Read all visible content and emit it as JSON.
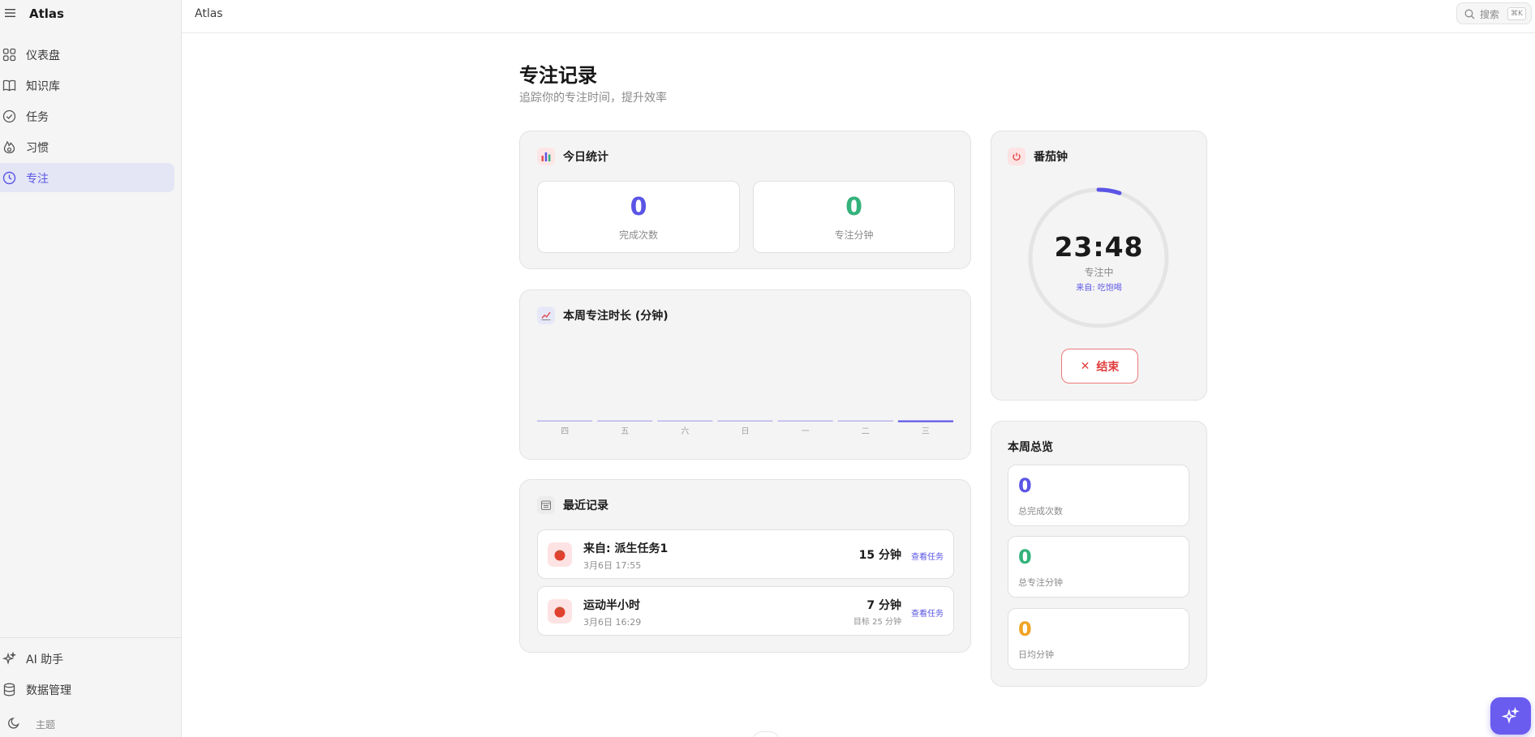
{
  "app": {
    "name": "Atlas"
  },
  "sidebar": {
    "items": [
      {
        "label": "仪表盘",
        "icon": "dashboard-icon"
      },
      {
        "label": "知识库",
        "icon": "book-icon"
      },
      {
        "label": "任务",
        "icon": "check-circle-icon"
      },
      {
        "label": "习惯",
        "icon": "flame-icon"
      },
      {
        "label": "专注",
        "icon": "clock-icon",
        "active": true
      }
    ],
    "bottom": [
      {
        "label": "AI 助手",
        "icon": "sparkle-icon"
      },
      {
        "label": "数据管理",
        "icon": "database-icon"
      },
      {
        "label": "主题",
        "icon": "moon-icon"
      }
    ]
  },
  "topbar": {
    "breadcrumb": "Atlas",
    "search_placeholder": "搜索",
    "search_shortcut": "⌘K"
  },
  "page": {
    "title": "专注记录",
    "subtitle": "追踪你的专注时间，提升效率"
  },
  "today": {
    "title": "今日统计",
    "completed": {
      "value": "0",
      "label": "完成次数"
    },
    "minutes": {
      "value": "0",
      "label": "专注分钟"
    }
  },
  "week_chart": {
    "title": "本周专注时长 (分钟)"
  },
  "chart_data": {
    "type": "bar",
    "title": "本周专注时长 (分钟)",
    "categories": [
      "四",
      "五",
      "六",
      "日",
      "一",
      "二",
      "三"
    ],
    "values": [
      0,
      0,
      0,
      0,
      0,
      0,
      0
    ],
    "highlight_index": 6
  },
  "recent": {
    "title": "最近记录",
    "items": [
      {
        "title": "来自: 派生任务1",
        "time": "3月6日 17:55",
        "duration": "15 分钟",
        "goal": "",
        "link": "查看任务"
      },
      {
        "title": "运动半小时",
        "time": "3月6日 16:29",
        "duration": "7 分钟",
        "goal": "目标 25 分钟",
        "link": "查看任务"
      }
    ]
  },
  "pomodoro": {
    "title": "番茄钟",
    "time": "23:48",
    "state": "专注中",
    "source": "来自: 吃饱喝",
    "progress": 0.05,
    "end_label": "结束"
  },
  "overview": {
    "title": "本周总览",
    "items": [
      {
        "value": "0",
        "label": "总完成次数",
        "color": "#5b55e6"
      },
      {
        "value": "0",
        "label": "总专注分钟",
        "color": "#34b27b"
      },
      {
        "value": "0",
        "label": "日均分钟",
        "color": "#f0a324"
      }
    ]
  },
  "colors": {
    "accent": "#5b55e6",
    "green": "#34b27b",
    "orange": "#f0a324",
    "danger": "#e23d3d"
  }
}
